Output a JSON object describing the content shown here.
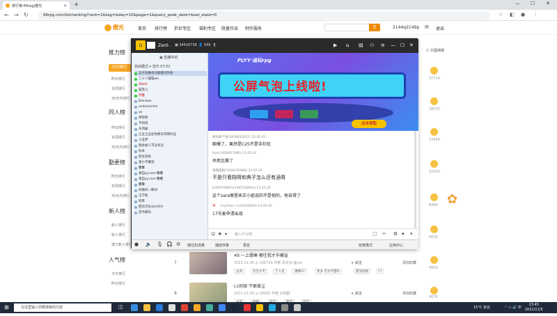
{
  "browser": {
    "tab_title": "排行榜-66rpg|橙光",
    "new_tab": "+",
    "url": "66rpg.com/list/ranking?rank=1&tag=&day=10&page=1&query_peak_date=&set_state=0"
  },
  "site": {
    "logo": "橙光",
    "nav": [
      "首页",
      "排行榜",
      "折扣专区",
      "福利专区",
      "限量作品",
      "制作服务"
    ],
    "user_id": "2144q2149p",
    "logout": "退出",
    "only_complete": "只显完结"
  },
  "left_ranks": [
    {
      "title": "推力榜",
      "items": [
        "今日排行",
        "昨日排行",
        "本周排行",
        "30天内排行"
      ]
    },
    {
      "title": "同人榜",
      "items": [
        "昨日排行",
        "本周排行",
        "30天内排行"
      ]
    },
    {
      "title": "勤更榜",
      "items": [
        "昨日排行",
        "本周排行",
        "30天内排行"
      ]
    },
    {
      "title": "新人榜",
      "items": [
        "新人排行",
        "新人排行",
        "潜力新人排行"
      ]
    },
    {
      "title": "人气榜",
      "items": [
        "今日排行",
        "昨日排行"
      ]
    }
  ],
  "right_counts": [
    "37714",
    "16035",
    "12549",
    "10030",
    "8494",
    "6638",
    "4950",
    "4076"
  ],
  "list_items": [
    {
      "rank": "7",
      "title": "49:一上缰绳·哪往我才华横溢",
      "date": "2021-11-05",
      "views": "106729",
      "author": "作者 青衣云·画nw",
      "follow": "+ 关注",
      "add": "添加收藏",
      "tags": [
        "古风",
        "双宫大宅",
        "万人迷",
        "爆爆CP",
        "更多·无谷不甜料",
        "甜宠成瘾",
        "L2"
      ]
    },
    {
      "rank": "8",
      "title": "L1初级·不敢爱尘",
      "date": "2021-11-03",
      "views": "20065",
      "author": "作者 白鸦鹤",
      "follow": "+ 关注",
      "add": "添加收藏",
      "tags": [
        "古风",
        "明阁",
        "后宫",
        "甜宠",
        "四宝"
      ]
    }
  ],
  "yy": {
    "home_icon": "⌂",
    "user_name": "Zard-",
    "room_id": "34416738",
    "online": "549",
    "mode": "自由模式 ▾ 音乐 07:02",
    "channel_header": "直播中的",
    "channel_list": [
      "这才叫做有问题看问卦啦",
      "二十八喵喵wa",
      "Abaih",
      "猫卷儿",
      "丹维",
      "Bainwas",
      "enduisanhai",
      "yo",
      "呼啦啦",
      "不知道",
      "东风破",
      "土豆土豆往你那东风拜好运",
      "小丑伊",
      "我会被人骂没有没",
      "标本",
      "帮主就免",
      "迷小不藏话",
      "馨馨",
      "来自yy.com·馨馨",
      "来自yy.com·馨馨",
      "馨馨",
      "拆散的一瞬间",
      "王学聪",
      "奶茶",
      "西瓜可乐abc919",
      "百鸟朝凤"
    ],
    "banner_sub": "PLYY·追玩rpg",
    "banner_title": "公屏气泡上线啦!",
    "banner_btn": "点击领取",
    "chat": [
      {
        "meta": "橙光那个钱(1858815451)  23:45:42",
        "msg": "聊爆了，果然是C2S不是寺社吃"
      },
      {
        "meta": "Rosi(1926607086)  23:45:43",
        "msg": "杀死比赛了"
      },
      {
        "meta": "请假姐姐(1428432088)  23:45:44",
        "msg": "不是只看翔哥和爽子怎么还有涵哥"
      },
      {
        "meta": "J1695558663(1695558663)  23:45:45",
        "msg": "这个sara哪里来正小姐说的不是他的，他自得了"
      },
      {
        "meta": "hryChen~(128550994)  23:45:46",
        "msg": "17号麦申请出战"
      }
    ],
    "chat_placeholder": "输入什么吧...",
    "bottom": [
      "接住扣流量",
      "播放伴奏",
      "录音",
      "抢麦模式",
      "应用中心"
    ]
  },
  "taskbar": {
    "search_placeholder": "在这里输入你要搜索的内容",
    "weather": "15°C 多云",
    "time": "23:45",
    "date": "2021/11/5"
  }
}
